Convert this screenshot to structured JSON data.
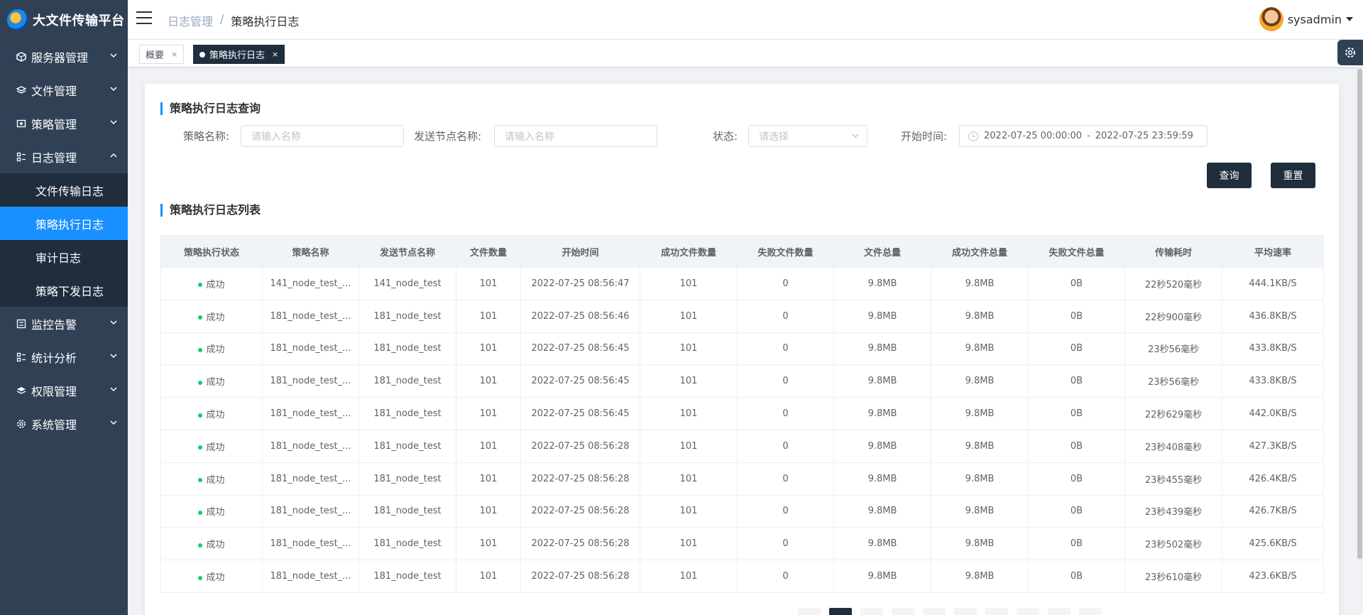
{
  "app": {
    "title": "大文件传输平台"
  },
  "sidebar": {
    "items": [
      {
        "label": "服务器管理",
        "icon": "server-icon",
        "expanded": false
      },
      {
        "label": "文件管理",
        "icon": "layers-icon",
        "expanded": false
      },
      {
        "label": "策略管理",
        "icon": "policy-icon",
        "expanded": false
      },
      {
        "label": "日志管理",
        "icon": "log-icon",
        "expanded": true,
        "children": [
          {
            "label": "文件传输日志",
            "active": false
          },
          {
            "label": "策略执行日志",
            "active": true
          },
          {
            "label": "审计日志",
            "active": false
          },
          {
            "label": "策略下发日志",
            "active": false
          }
        ]
      },
      {
        "label": "监控告警",
        "icon": "monitor-icon",
        "expanded": false
      },
      {
        "label": "统计分析",
        "icon": "stats-icon",
        "expanded": false
      },
      {
        "label": "权限管理",
        "icon": "permission-icon",
        "expanded": false
      },
      {
        "label": "系统管理",
        "icon": "gear-icon",
        "expanded": false
      }
    ]
  },
  "header": {
    "breadcrumb": [
      "日志管理",
      "策略执行日志"
    ],
    "user": "sysadmin"
  },
  "tags": [
    {
      "label": "概要",
      "active": false,
      "close": "×"
    },
    {
      "label": "策略执行日志",
      "active": true,
      "close": "×"
    }
  ],
  "search": {
    "title": "策略执行日志查询",
    "policy_name_label": "策略名称:",
    "policy_name_placeholder": "请输入名称",
    "node_name_label": "发送节点名称:",
    "node_name_placeholder": "请输入名称",
    "status_label": "状态:",
    "status_placeholder": "请选择",
    "start_time_label": "开始时间:",
    "start_time_from": "2022-07-25 00:00:00",
    "start_time_sep": "-",
    "start_time_to": "2022-07-25 23:59:59",
    "query_label": "查询",
    "reset_label": "重置"
  },
  "list": {
    "title": "策略执行日志列表",
    "columns": [
      "策略执行状态",
      "策略名称",
      "发送节点名称",
      "文件数量",
      "开始时间",
      "成功文件数量",
      "失败文件数量",
      "文件总量",
      "成功文件总量",
      "失败文件总量",
      "传输耗时",
      "平均速率"
    ],
    "rows": [
      [
        "成功",
        "141_node_test_...",
        "141_node_test",
        "101",
        "2022-07-25 08:56:47",
        "101",
        "0",
        "9.8MB",
        "9.8MB",
        "0B",
        "22秒520毫秒",
        "444.1KB/S"
      ],
      [
        "成功",
        "181_node_test_...",
        "181_node_test",
        "101",
        "2022-07-25 08:56:46",
        "101",
        "0",
        "9.8MB",
        "9.8MB",
        "0B",
        "22秒900毫秒",
        "436.8KB/S"
      ],
      [
        "成功",
        "181_node_test_...",
        "181_node_test",
        "101",
        "2022-07-25 08:56:45",
        "101",
        "0",
        "9.8MB",
        "9.8MB",
        "0B",
        "23秒56毫秒",
        "433.8KB/S"
      ],
      [
        "成功",
        "181_node_test_...",
        "181_node_test",
        "101",
        "2022-07-25 08:56:45",
        "101",
        "0",
        "9.8MB",
        "9.8MB",
        "0B",
        "23秒56毫秒",
        "433.8KB/S"
      ],
      [
        "成功",
        "181_node_test_...",
        "181_node_test",
        "101",
        "2022-07-25 08:56:45",
        "101",
        "0",
        "9.8MB",
        "9.8MB",
        "0B",
        "22秒629毫秒",
        "442.0KB/S"
      ],
      [
        "成功",
        "181_node_test_...",
        "181_node_test",
        "101",
        "2022-07-25 08:56:28",
        "101",
        "0",
        "9.8MB",
        "9.8MB",
        "0B",
        "23秒408毫秒",
        "427.3KB/S"
      ],
      [
        "成功",
        "181_node_test_...",
        "181_node_test",
        "101",
        "2022-07-25 08:56:28",
        "101",
        "0",
        "9.8MB",
        "9.8MB",
        "0B",
        "23秒455毫秒",
        "426.4KB/S"
      ],
      [
        "成功",
        "181_node_test_...",
        "181_node_test",
        "101",
        "2022-07-25 08:56:28",
        "101",
        "0",
        "9.8MB",
        "9.8MB",
        "0B",
        "23秒439毫秒",
        "426.7KB/S"
      ],
      [
        "成功",
        "181_node_test_...",
        "181_node_test",
        "101",
        "2022-07-25 08:56:28",
        "101",
        "0",
        "9.8MB",
        "9.8MB",
        "0B",
        "23秒502毫秒",
        "425.6KB/S"
      ],
      [
        "成功",
        "181_node_test_...",
        "181_node_test",
        "101",
        "2022-07-25 08:56:28",
        "101",
        "0",
        "9.8MB",
        "9.8MB",
        "0B",
        "23秒610毫秒",
        "423.6KB/S"
      ]
    ]
  },
  "colors": {
    "sidebar_bg": "#304156",
    "active_blue": "#1890ff",
    "dark_btn": "#1f2d3d",
    "success": "#13ce66"
  }
}
